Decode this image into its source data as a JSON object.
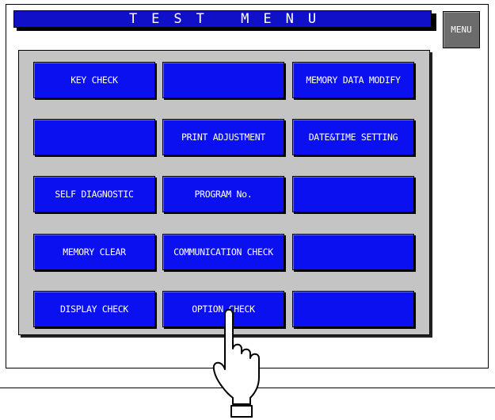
{
  "header": {
    "title": "TEST MENU"
  },
  "menu_button": {
    "label": "MENU"
  },
  "menu": {
    "buttons": [
      {
        "label": "KEY CHECK"
      },
      {
        "label": ""
      },
      {
        "label": "MEMORY DATA MODIFY"
      },
      {
        "label": ""
      },
      {
        "label": "PRINT ADJUSTMENT"
      },
      {
        "label": "DATE&TIME SETTING"
      },
      {
        "label": "SELF DIAGNOSTIC"
      },
      {
        "label": "PROGRAM No."
      },
      {
        "label": ""
      },
      {
        "label": "MEMORY CLEAR"
      },
      {
        "label": "COMMUNICATION CHECK"
      },
      {
        "label": ""
      },
      {
        "label": "DISPLAY CHECK"
      },
      {
        "label": "OPTION CHECK"
      },
      {
        "label": ""
      }
    ]
  },
  "icons": {
    "pointer": "pointing-hand-icon"
  },
  "colors": {
    "title_bar": "#1010c8",
    "button": "#0a10f0",
    "panel": "#c4c4c4",
    "menu_button": "#6c6c6c"
  }
}
